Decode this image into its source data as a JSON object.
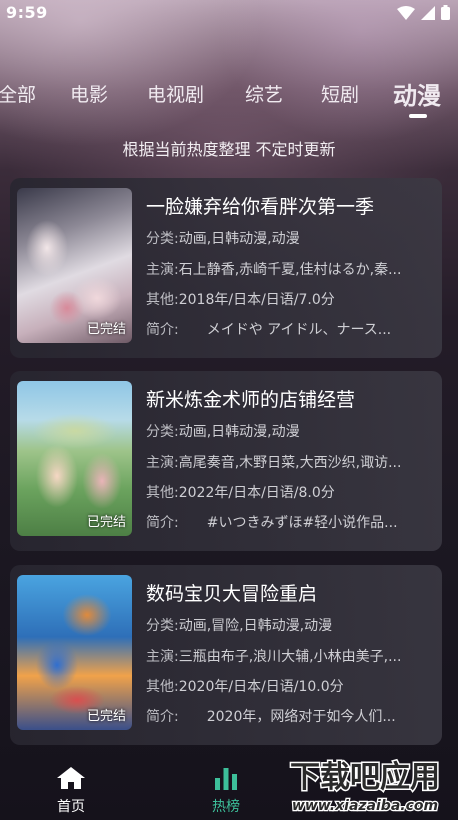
{
  "status_bar": {
    "time": "9:59"
  },
  "tabs": [
    {
      "label": "全部",
      "active": false
    },
    {
      "label": "电影",
      "active": false
    },
    {
      "label": "电视剧",
      "active": false
    },
    {
      "label": "综艺",
      "active": false
    },
    {
      "label": "短剧",
      "active": false
    },
    {
      "label": "动漫",
      "active": true
    }
  ],
  "subtitle": "根据当前热度整理 不定时更新",
  "labels": {
    "category": "分类:",
    "cast": "主演:",
    "other": "其他:",
    "intro": "简介:"
  },
  "cards": [
    {
      "title": "一脸嫌弃给你看胖次第一季",
      "badge": "已完结",
      "category": "动画,日韩动漫,动漫",
      "cast": "石上静香,赤崎千夏,佳村はるか,秦...",
      "other": "2018年/日本/日语/7.0分",
      "intro": "　　メイドや アイドル、ナース..."
    },
    {
      "title": "新米炼金术师的店铺经营",
      "badge": "已完结",
      "category": "动画,日韩动漫,动漫",
      "cast": "高尾奏音,木野日菜,大西沙织,诹访...",
      "other": "2022年/日本/日语/8.0分",
      "intro": "　　#いつきみずほ#轻小说作品..."
    },
    {
      "title": "数码宝贝大冒险重启",
      "badge": "已完结",
      "category": "动画,冒险,日韩动漫,动漫",
      "cast": "三瓶由布子,浪川大辅,小林由美子,...",
      "other": "2020年/日本/日语/10.0分",
      "intro": "　　2020年，网络对于如今人们..."
    }
  ],
  "bottom_nav": [
    {
      "label": "首页",
      "icon": "home-icon",
      "active": false
    },
    {
      "label": "热榜",
      "icon": "bar-chart-icon",
      "active": true
    }
  ],
  "watermark": {
    "title": "下载吧应用",
    "url": "www.xiazaiba.com"
  },
  "colors": {
    "accent": "#3dbf9a",
    "card_bg": "#2e2c36",
    "text_muted": "#cfcfd4"
  }
}
